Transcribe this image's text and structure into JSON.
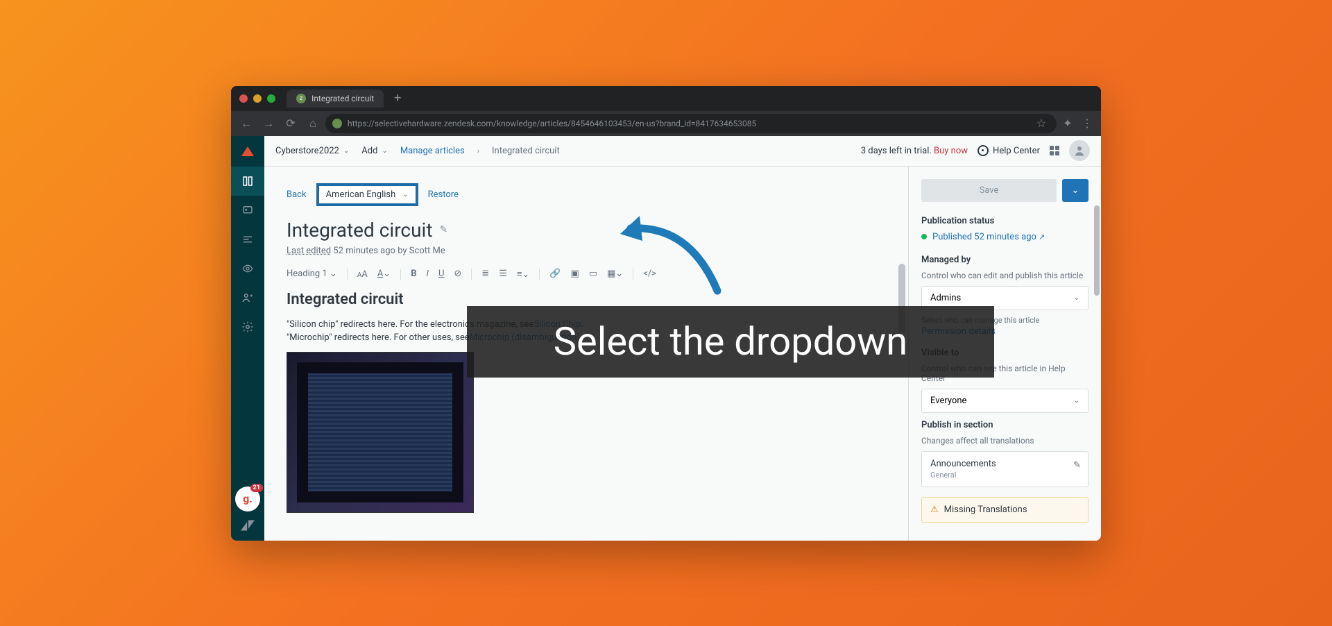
{
  "browser": {
    "tab_title": "Integrated circuit",
    "url": "https://selectivehardware.zendesk.com/knowledge/articles/8454646103453/en-us?brand_id=8417634653085"
  },
  "topbar": {
    "workspace": "Cyberstore2022",
    "add": "Add",
    "manage": "Manage articles",
    "crumb": "Integrated circuit",
    "trial": "3 days left in trial.",
    "buy": "Buy now",
    "help": "Help Center"
  },
  "editor": {
    "back": "Back",
    "language": "American English",
    "restore": "Restore",
    "title": "Integrated circuit",
    "last_edited_label": "Last edited",
    "last_edited_rest": "52 minutes ago by Scott Me",
    "heading_style": "Heading 1",
    "body_heading": "Integrated circuit",
    "redirect1_prefix": "\"Silicon chip\" redirects here. For the electronics magazine, see",
    "redirect1_link": "Silicon Chip",
    "redirect2_prefix": "\"Microchip\" redirects here. For other uses, see",
    "redirect2_link": "Microchip (disambiguation)"
  },
  "panel": {
    "save": "Save",
    "pub_status_h": "Publication status",
    "pub_text": "Published 52 minutes ago",
    "managed_h": "Managed by",
    "managed_sub": "Control who can edit and publish this article",
    "managed_val": "Admins",
    "managed_hint": "Select who can manage this article",
    "perm_link": "Permission details",
    "visible_h": "Visible to",
    "visible_sub": "Control who can see this article in Help Center",
    "visible_val": "Everyone",
    "section_h": "Publish in section",
    "section_sub": "Changes affect all translations",
    "section_name": "Announcements",
    "section_cat": "General",
    "warning": "Missing Translations"
  },
  "annotation": {
    "text": "Select the dropdown"
  },
  "badge": {
    "g_count": "21"
  }
}
